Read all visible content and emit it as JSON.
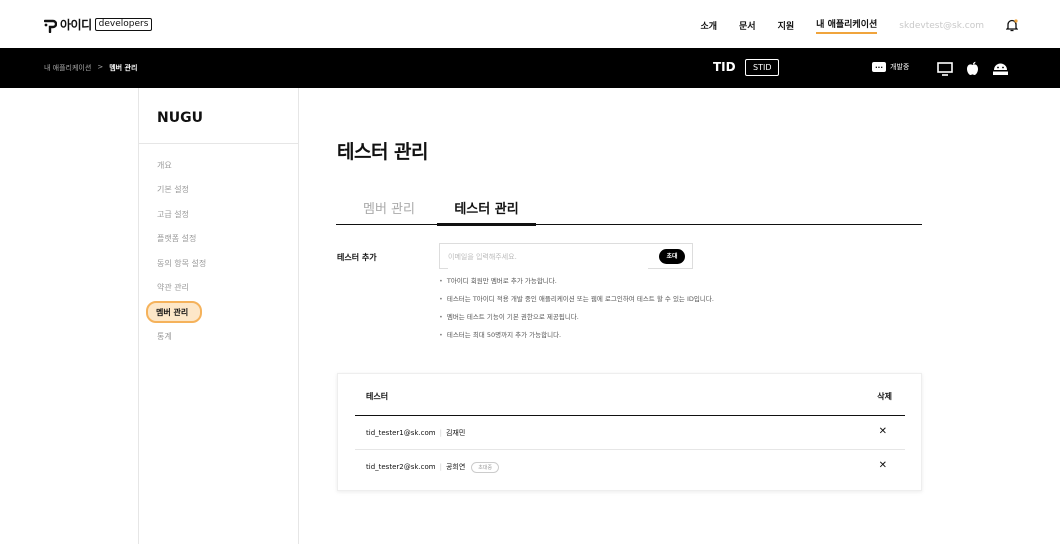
{
  "header": {
    "logo_text": "아이디",
    "logo_badge": "developers",
    "nav": [
      {
        "label": "소개"
      },
      {
        "label": "문서"
      },
      {
        "label": "지원"
      },
      {
        "label": "내 애플리케이션"
      }
    ],
    "user_email": "skdevtest@sk.com",
    "accent_color": "#f0a43c"
  },
  "subbar": {
    "breadcrumb": [
      "내 애플리케이션",
      ">",
      "멤버 관리"
    ],
    "service": "TID",
    "service_badge": "STID",
    "dev_mode_icon": "...",
    "dev_mode_label": "개발중",
    "platform_icons": [
      "monitor-icon",
      "apple-icon",
      "android-icon"
    ]
  },
  "sidebar": {
    "app_name": "NUGU",
    "items": [
      {
        "label": "개요"
      },
      {
        "label": "기본 설정"
      },
      {
        "label": "고급 설정"
      },
      {
        "label": "플랫폼 설정"
      },
      {
        "label": "동의 항목 설정"
      },
      {
        "label": "약관 관리"
      },
      {
        "label": "멤버 관리"
      },
      {
        "label": "통계"
      }
    ]
  },
  "main": {
    "title": "테스터 관리",
    "tabs": [
      {
        "label": "멤버 관리"
      },
      {
        "label": "테스터 관리"
      }
    ],
    "add_label": "테스터 추가",
    "input_placeholder": "이메일을 입력해주세요.",
    "invite_button": "초대",
    "notes": [
      "T아이디 회원만 멤버로 추가 가능합니다.",
      "테스터는 T아이디 적용 개발 중인 애플리케이션 또는 웹에 로그인하여 테스트 할 수 있는 ID입니다.",
      "멤버는 테스트 기능이 기본 권한으로 제공됩니다.",
      "테스터는 최대 50명까지 추가 가능합니다."
    ],
    "table": {
      "col_tester": "테스터",
      "col_delete": "삭제",
      "rows": [
        {
          "email": "tid_tester1@sk.com",
          "sep": "|",
          "name": "김재민",
          "badge": "",
          "delete": "✕"
        },
        {
          "email": "tid_tester2@sk.com",
          "sep": "|",
          "name": "공희연",
          "badge": "초대중",
          "delete": "✕"
        }
      ]
    }
  }
}
